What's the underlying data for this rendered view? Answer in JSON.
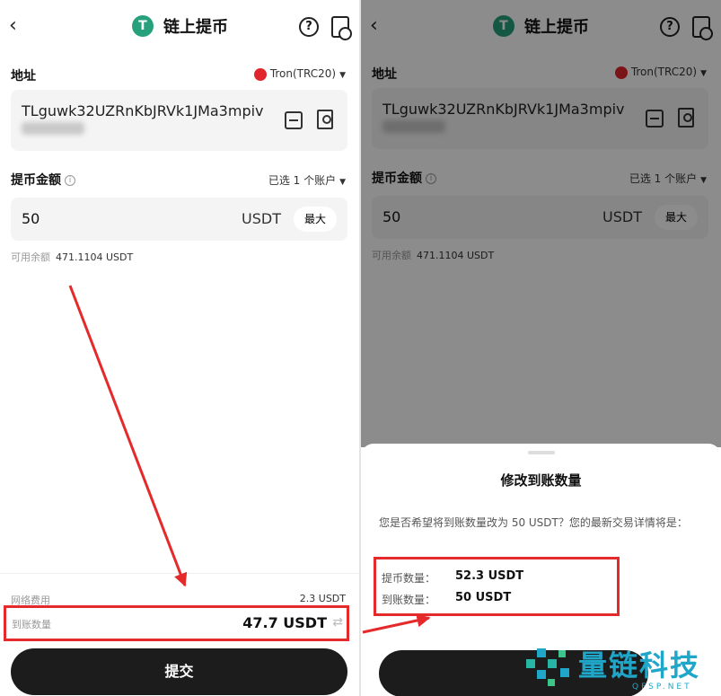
{
  "left": {
    "header": {
      "title": "链上提币",
      "tether_symbol": "T"
    },
    "address": {
      "label": "地址",
      "network": "Tron(TRC20)",
      "value": "TLguwk32UZRnKbJRVk1JMa3mpiv"
    },
    "amount": {
      "label": "提币金额",
      "account_select": "已选 1 个账户",
      "value": "50",
      "unit": "USDT",
      "max_label": "最大"
    },
    "available": {
      "label": "可用余额",
      "value": "471.1104 USDT"
    },
    "fee": {
      "label": "网络费用",
      "value": "2.3 USDT"
    },
    "received": {
      "label": "到账数量",
      "value": "47.7 USDT"
    },
    "submit_label": "提交"
  },
  "right": {
    "header": {
      "title": "链上提币",
      "tether_symbol": "T"
    },
    "address": {
      "label": "地址",
      "network": "Tron(TRC20)",
      "value": "TLguwk32UZRnKbJRVk1JMa3mpiv"
    },
    "amount": {
      "label": "提币金额",
      "account_select": "已选 1 个账户",
      "value": "50",
      "unit": "USDT",
      "max_label": "最大"
    },
    "available": {
      "label": "可用余额",
      "value": "471.1104 USDT"
    },
    "dialog": {
      "title": "修改到账数量",
      "description": "您是否希望将到账数量改为 50 USDT？您的最新交易详情将是：",
      "withdraw_label": "提币数量：",
      "withdraw_value": "52.3 USDT",
      "receive_label": "到账数量：",
      "receive_value": "50 USDT"
    }
  },
  "watermark": {
    "text": "量链科技",
    "sub": "QFSP.NET"
  },
  "colors": {
    "highlight": "#e42a2a",
    "tether": "#26a17b",
    "tron": "#e0252c",
    "button": "#1c1c1c",
    "watermark": "#1fa6c9"
  }
}
